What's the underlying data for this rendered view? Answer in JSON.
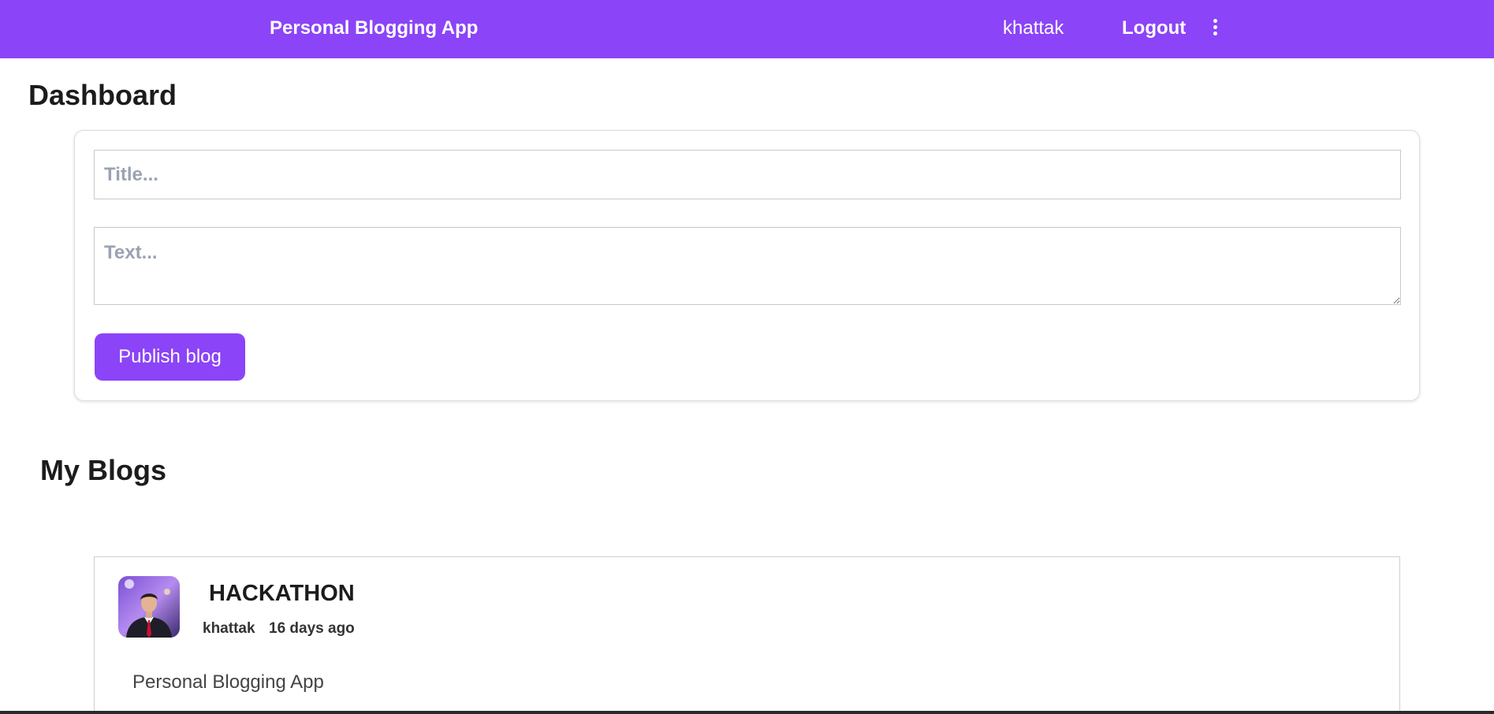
{
  "header": {
    "brand": "Personal Blogging App",
    "username": "khattak",
    "logout_label": "Logout",
    "menu_icon": "more-vertical-icon",
    "background_color": "#8b44f7"
  },
  "dashboard": {
    "title": "Dashboard",
    "title_placeholder": "Title...",
    "title_value": "",
    "text_placeholder": "Text...",
    "text_value": "",
    "publish_label": "Publish blog"
  },
  "blogs": {
    "section_title": "My Blogs",
    "items": [
      {
        "title": "HACKATHON",
        "author": "khattak",
        "date": "16 days ago",
        "body": "Personal Blogging App",
        "avatar": "author-photo"
      }
    ]
  },
  "colors": {
    "accent": "#8b44f7",
    "text_dark": "#1c1c1c",
    "placeholder": "#9aa3b2"
  }
}
